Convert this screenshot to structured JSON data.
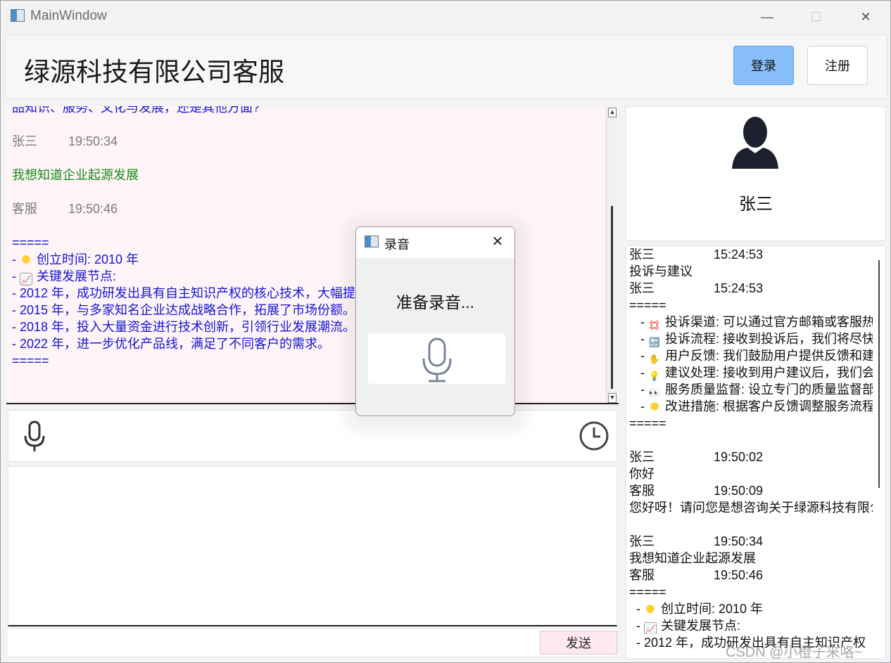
{
  "window": {
    "title": "MainWindow",
    "minimize": "—",
    "maximize": "☐",
    "close": "✕"
  },
  "header": {
    "company": "绿源科技有限公司客服",
    "login": "登录",
    "register": "注册"
  },
  "chat": {
    "partial_line": "品知识、服务、文化与发展，还是其他方面?",
    "msg1_sender": "张三",
    "msg1_time": "19:50:34",
    "msg1_text": "我想知道企业起源发展",
    "msg2_sender": "客服",
    "msg2_time": "19:50:46",
    "sep": "=====",
    "l1": "- ",
    "l1_text": "创立时间: 2010 年",
    "l2": "- ",
    "l2_text": "关键发展节点:",
    "l3": "- 2012 年，成功研发出具有自主知识产权的核心技术，大幅提",
    "l4": "- 2015 年，与多家知名企业达成战略合作，拓展了市场份额。",
    "l5": "- 2018 年，投入大量资金进行技术创新，引领行业发展潮流。",
    "l6": "- 2022 年，进一步优化产品线，满足了不同客户的需求。",
    "sep2": "=====",
    "scroll_up": "▲",
    "scroll_down": "▼"
  },
  "bottom": {
    "send": "发送"
  },
  "profile": {
    "name": "张三"
  },
  "history": {
    "h1_sender": "张三",
    "h1_time": "15:24:53",
    "h1_text": "投诉与建议",
    "h2_sender": "张三",
    "h2_time": "15:24:53",
    "sep": "=====",
    "b1": "投诉渠道: 可以通过官方邮箱或客服热",
    "b2": "投诉流程: 接收到投诉后，我们将尽快",
    "b3": "用户反馈: 我们鼓励用户提供反馈和建",
    "b4": "建议处理: 接收到用户建议后，我们会",
    "b5": "服务质量监督: 设立专门的质量监督部",
    "b6": "改进措施: 根据客户反馈调整服务流程",
    "sep2": "=====",
    "h3_sender": "张三",
    "h3_time": "19:50:02",
    "h3_text": "你好",
    "h4_sender": "客服",
    "h4_time": "19:50:09",
    "h4_text": "您好呀！请问您是想咨询关于绿源科技有限公司",
    "h5_sender": "张三",
    "h5_time": "19:50:34",
    "h5_text": "我想知道企业起源发展",
    "h6_sender": "客服",
    "h6_time": "19:50:46",
    "sep3": "=====",
    "c1": "创立时间: 2010 年",
    "c2": "关键发展节点:",
    "c3": "- 2012 年，成功研发出具有自主知识产权"
  },
  "dialog": {
    "title": "录音",
    "close": "✕",
    "status": "准备录音..."
  },
  "watermark": "CSDN @小橙子来咯~"
}
